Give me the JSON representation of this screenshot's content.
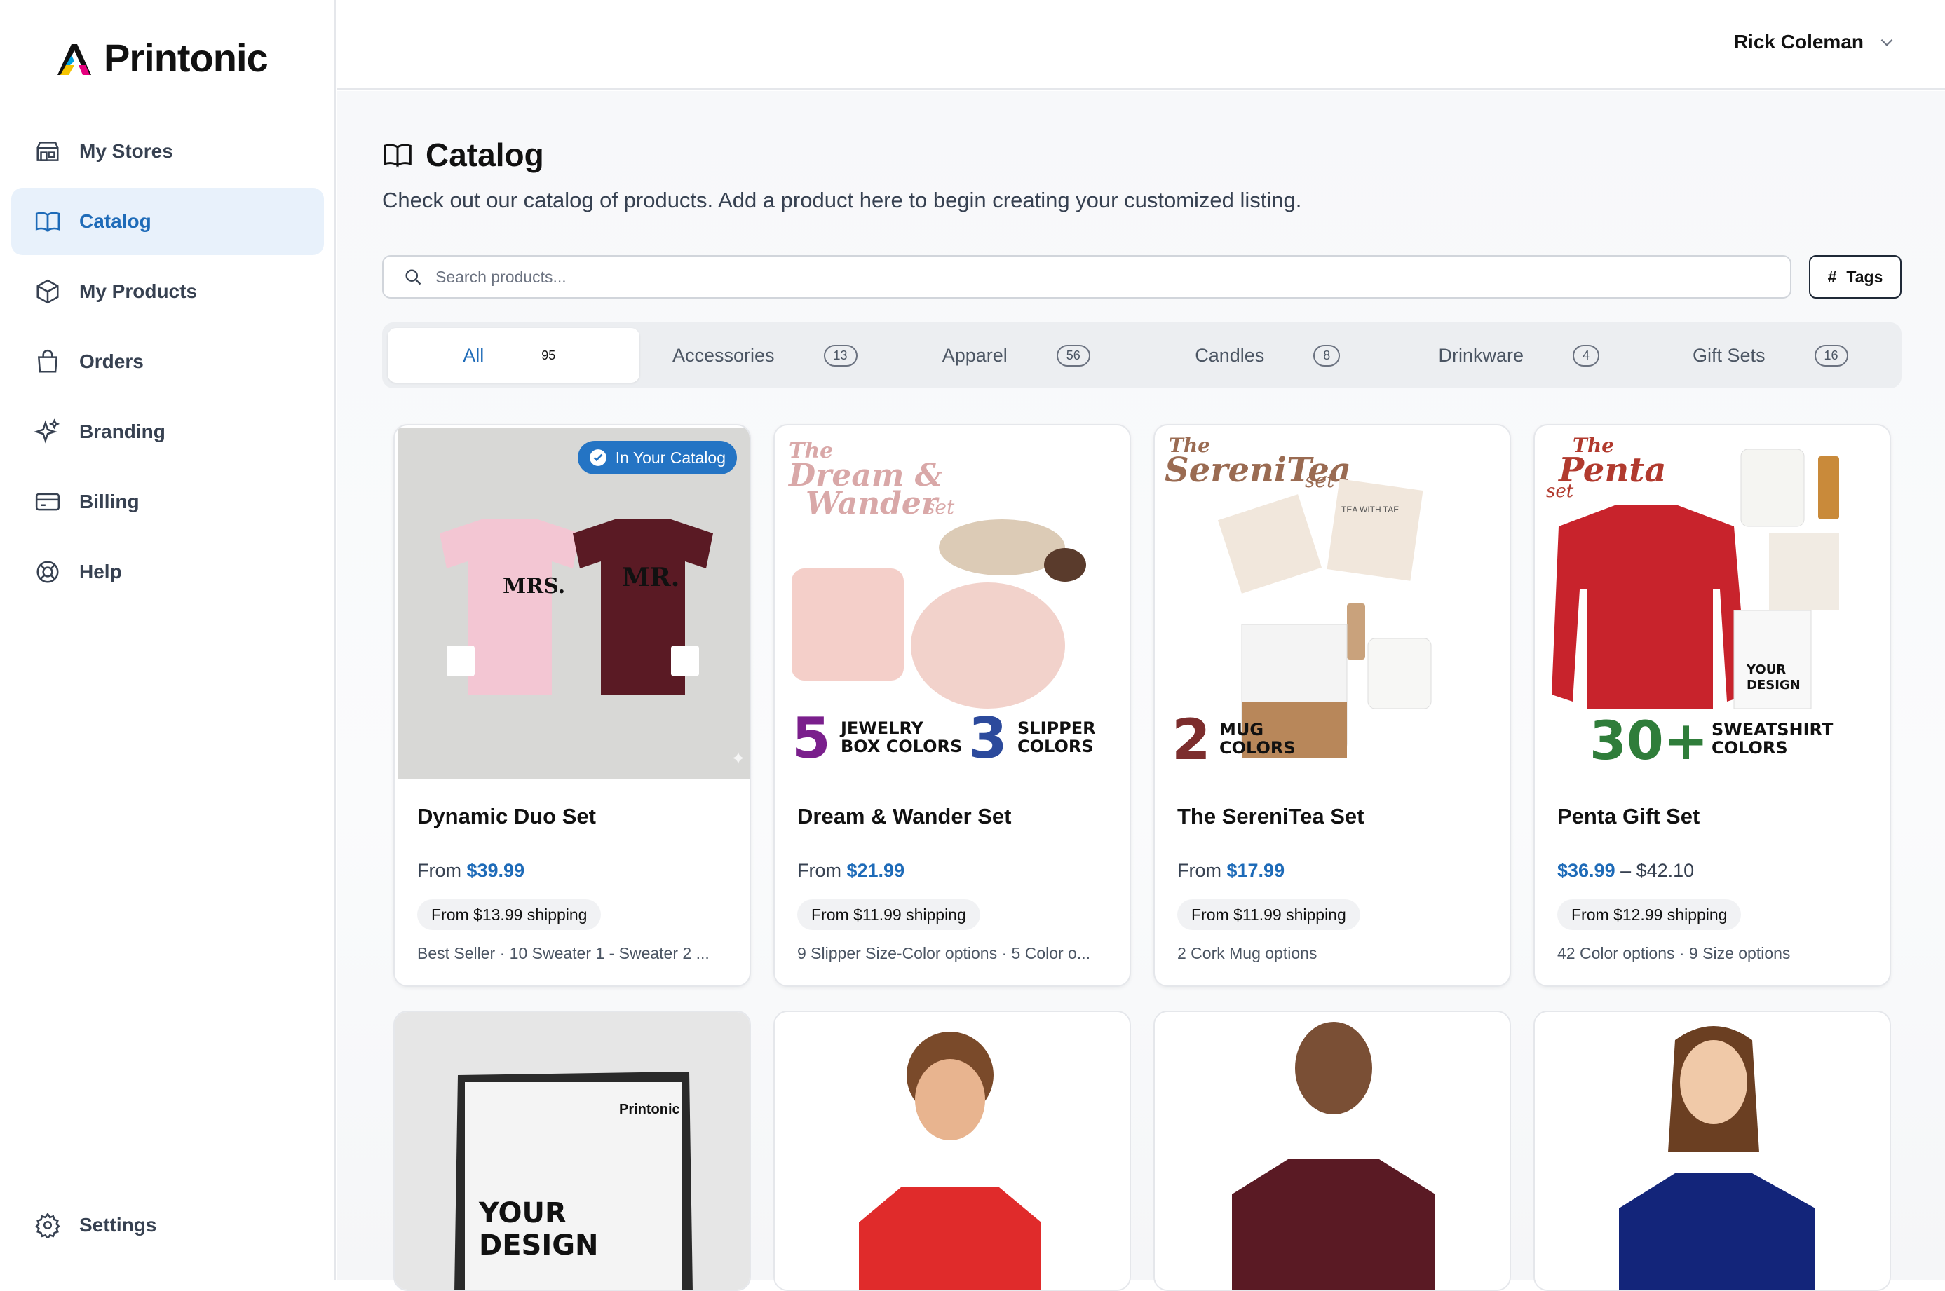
{
  "brand": {
    "name": "Printonic"
  },
  "user": {
    "name": "Rick Coleman"
  },
  "sidebar": {
    "items": [
      {
        "label": "My Stores"
      },
      {
        "label": "Catalog"
      },
      {
        "label": "My Products"
      },
      {
        "label": "Orders"
      },
      {
        "label": "Branding"
      },
      {
        "label": "Billing"
      },
      {
        "label": "Help"
      }
    ],
    "settings": "Settings"
  },
  "page": {
    "title": "Catalog",
    "subtitle": "Check out our catalog of products. Add a product here to begin creating your customized listing."
  },
  "search": {
    "placeholder": "Search products..."
  },
  "tags_button": {
    "label": "Tags",
    "symbol": "#"
  },
  "tabs": [
    {
      "label": "All",
      "count": "95"
    },
    {
      "label": "Accessories",
      "count": "13"
    },
    {
      "label": "Apparel",
      "count": "56"
    },
    {
      "label": "Candles",
      "count": "8"
    },
    {
      "label": "Drinkware",
      "count": "4"
    },
    {
      "label": "Gift Sets",
      "count": "16"
    }
  ],
  "products": [
    {
      "name": "Dynamic Duo Set",
      "price_prefix": "From ",
      "price": "$39.99",
      "price_suffix": "",
      "shipping": "From $13.99 shipping",
      "meta": "Best Seller · 10 Sweater 1 - Sweater 2 ...",
      "badge": "In Your Catalog",
      "img_text_a": "MRS.",
      "img_text_b": "MR."
    },
    {
      "name": "Dream & Wander Set",
      "price_prefix": "From ",
      "price": "$21.99",
      "price_suffix": "",
      "shipping": "From $11.99 shipping",
      "meta": "9 Slipper Size-Color options · 5 Color o...",
      "img_title_a": "The",
      "img_title_b": "Dream &",
      "img_title_c": "Wander",
      "img_title_d": "set",
      "img_num_a": "5",
      "img_cap_a1": "JEWELRY",
      "img_cap_a2": "BOX COLORS",
      "img_num_b": "3",
      "img_cap_b1": "SLIPPER",
      "img_cap_b2": "COLORS"
    },
    {
      "name": "The SereniTea Set",
      "price_prefix": "From ",
      "price": "$17.99",
      "price_suffix": "",
      "shipping": "From $11.99 shipping",
      "meta": "2 Cork Mug options",
      "img_title_a": "The",
      "img_title_b": "SereniTea",
      "img_title_c": "set",
      "img_num": "2",
      "img_cap1": "MUG",
      "img_cap2": "COLORS",
      "img_tea": "TEA WITH TAE"
    },
    {
      "name": "Penta Gift Set",
      "price_prefix": "",
      "price": "$36.99",
      "price_suffix": " – $42.10",
      "shipping": "From $12.99 shipping",
      "meta": "42 Color options · 9 Size options",
      "img_title_a": "The",
      "img_title_b": "Penta",
      "img_title_c": "set",
      "img_num": "30+",
      "img_cap1": "SWEATSHIRT",
      "img_cap2": "COLORS",
      "img_mug1": "YOUR",
      "img_mug2": "DESIGN"
    }
  ],
  "row2": {
    "slate_brand": "Printonic",
    "slate_text1": "YOUR",
    "slate_text2": "DESIGN"
  },
  "colors": {
    "accent": "#1e6bb8",
    "active_bg": "#e8f1fb",
    "badge": "#2474c4"
  }
}
